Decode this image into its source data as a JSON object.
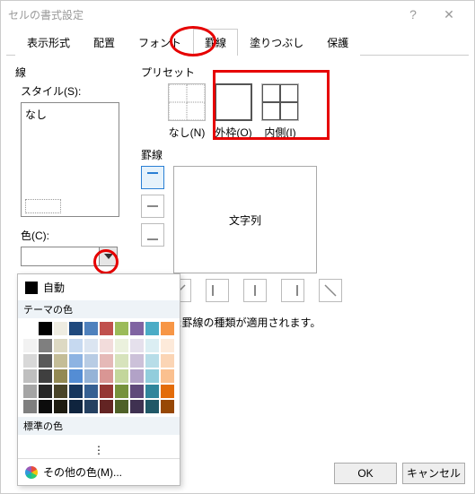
{
  "title": "セルの書式設定",
  "tabs": [
    "表示形式",
    "配置",
    "フォント",
    "罫線",
    "塗りつぶし",
    "保護"
  ],
  "left": {
    "line_group": "線",
    "style_label": "スタイル(S):",
    "style_none": "なし",
    "color_label": "色(C):"
  },
  "preset": {
    "label": "プリセット",
    "none": "なし(N)",
    "outline": "外枠(O)",
    "inside": "内側(I)"
  },
  "keisen": {
    "label": "罫線",
    "preview_text": "文字列"
  },
  "msg": "プレビュー枠内または上のボタンをクリックすると、選択した罫線の種類が適用されます。",
  "msg_visible_tail": "すると、選択した罫線の種類が適用されます。",
  "picker": {
    "auto": "自動",
    "theme": "テーマの色",
    "standard": "標準の色",
    "more": "その他の色(M)...",
    "ellipsis": "⋮",
    "theme_colors_row1": [
      "#ffffff",
      "#000000",
      "#eeece1",
      "#1f497d",
      "#4f81bd",
      "#c0504d",
      "#9bbb59",
      "#8064a2",
      "#4bacc6",
      "#f79646"
    ],
    "theme_shades": [
      [
        "#f2f2f2",
        "#7f7f7f",
        "#ddd9c3",
        "#c6d9f0",
        "#dbe5f1",
        "#f2dcdb",
        "#ebf1dd",
        "#e5e0ec",
        "#dbeef3",
        "#fdeada"
      ],
      [
        "#d8d8d8",
        "#595959",
        "#c4bd97",
        "#8db3e2",
        "#b8cce4",
        "#e5b9b7",
        "#d7e3bc",
        "#ccc1d9",
        "#b7dde8",
        "#fbd5b5"
      ],
      [
        "#bfbfbf",
        "#3f3f3f",
        "#938953",
        "#548dd4",
        "#95b3d7",
        "#d99694",
        "#c3d69b",
        "#b2a2c7",
        "#92cddc",
        "#fac08f"
      ],
      [
        "#a5a5a5",
        "#262626",
        "#494429",
        "#17365d",
        "#366092",
        "#953734",
        "#76923c",
        "#5f497a",
        "#31859b",
        "#e36c09"
      ],
      [
        "#7f7f7f",
        "#0c0c0c",
        "#1d1b10",
        "#0f243e",
        "#244061",
        "#632423",
        "#4f6128",
        "#3f3151",
        "#205867",
        "#974806"
      ]
    ],
    "standard_colors": [
      "#c00000",
      "#ff0000",
      "#ffc000",
      "#ffff00",
      "#92d050",
      "#00b050",
      "#00b0f0",
      "#0070c0",
      "#002060",
      "#7030a0"
    ]
  },
  "buttons": {
    "ok": "OK",
    "cancel": "キャンセル"
  }
}
